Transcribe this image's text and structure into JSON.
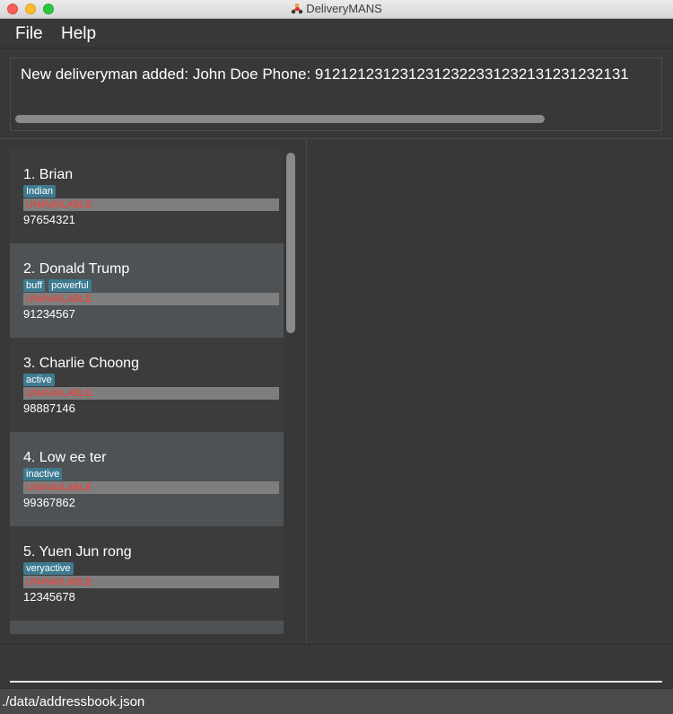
{
  "window": {
    "title": "DeliveryMANS",
    "app_icon": "delivery-scooter-icon"
  },
  "menu": {
    "file": "File",
    "help": "Help"
  },
  "result": {
    "message": "New deliveryman added: John Doe Phone: 9121212312312312322331232131231232131"
  },
  "deliverymen": [
    {
      "index_name": "1.  Brian",
      "tags": [
        "Indian"
      ],
      "status": "UNAVAILABLE",
      "phone": "97654321"
    },
    {
      "index_name": "2.  Donald Trump",
      "tags": [
        "buff",
        "powerful"
      ],
      "status": "UNAVAILABLE",
      "phone": "91234567"
    },
    {
      "index_name": "3.  Charlie Choong",
      "tags": [
        "active"
      ],
      "status": "UNAVAILABLE",
      "phone": "98887146"
    },
    {
      "index_name": "4.  Low ee ter",
      "tags": [
        "inactive"
      ],
      "status": "UNAVAILABLE",
      "phone": "99367862"
    },
    {
      "index_name": "5.  Yuen Jun rong",
      "tags": [
        "veryactive"
      ],
      "status": "UNAVAILABLE",
      "phone": "12345678"
    }
  ],
  "command": {
    "value": ""
  },
  "statusbar": {
    "save_location": "./data/addressbook.json"
  },
  "colors": {
    "tag": "#3e7b91",
    "unavailable_text": "#ff3b30",
    "status_bar_bg": "#7e7e7e"
  }
}
